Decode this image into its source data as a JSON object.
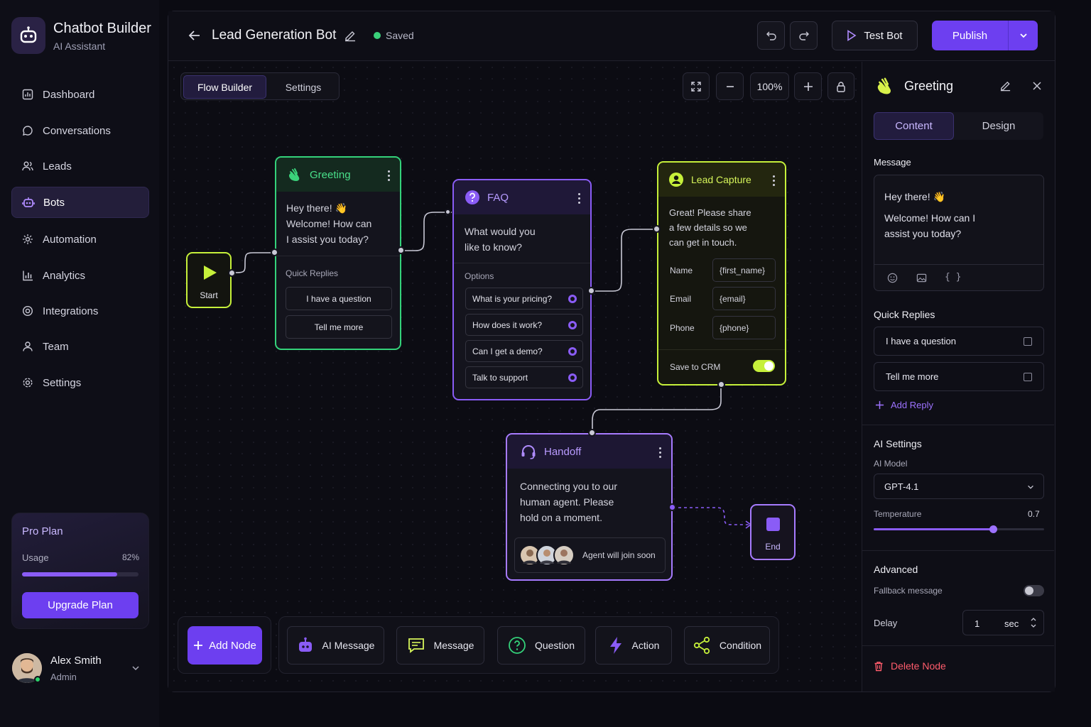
{
  "app": {
    "name": "Chatbot Builder",
    "subtitle": "AI Assistant"
  },
  "sidebar": {
    "items": [
      {
        "label": "Dashboard",
        "icon": "dashboard-icon"
      },
      {
        "label": "Conversations",
        "icon": "chat-bubble-icon"
      },
      {
        "label": "Leads",
        "icon": "users-icon"
      },
      {
        "label": "Bots",
        "icon": "bot-icon",
        "active": true
      },
      {
        "label": "Automation",
        "icon": "automation-icon"
      },
      {
        "label": "Analytics",
        "icon": "bar-chart-icon"
      },
      {
        "label": "Integrations",
        "icon": "integrations-icon"
      },
      {
        "label": "Team",
        "icon": "team-icon"
      },
      {
        "label": "Settings",
        "icon": "gear-icon"
      }
    ],
    "plan": {
      "title": "Pro Plan",
      "usage_label": "Usage",
      "usage_pct_label": "82%",
      "usage_fraction": 0.82,
      "upgrade_label": "Upgrade Plan"
    },
    "user": {
      "name": "Alex Smith",
      "role": "Admin"
    }
  },
  "header": {
    "bot_title": "Lead Generation Bot",
    "status": "Saved",
    "test_label": "Test Bot",
    "publish_label": "Publish"
  },
  "canvas": {
    "tabs": [
      "Flow Builder",
      "Settings"
    ],
    "zoom": "100%",
    "nodes": {
      "start": {
        "label": "Start"
      },
      "greeting": {
        "title": "Greeting",
        "message": [
          "Hey there! 👋",
          "Welcome! How can",
          "I assist you today?"
        ],
        "quick_replies_label": "Quick Replies",
        "quick_replies": [
          "I have a question",
          "Tell me more"
        ]
      },
      "faq": {
        "title": "FAQ",
        "message": [
          "What would you",
          "like to know?"
        ],
        "options_label": "Options",
        "options": [
          "What is your pricing?",
          "How does it work?",
          "Can I get a demo?",
          "Talk to support"
        ]
      },
      "lead_capture": {
        "title": "Lead Capture",
        "message": [
          "Great! Please share",
          "a few details so we",
          "can get in touch."
        ],
        "fields": [
          {
            "label": "Name",
            "value": "{first_name}"
          },
          {
            "label": "Email",
            "value": "{email}"
          },
          {
            "label": "Phone",
            "value": "{phone}"
          }
        ],
        "crm_label": "Save to CRM",
        "crm_enabled": true
      },
      "handoff": {
        "title": "Handoff",
        "message": [
          "Connecting you to our",
          "human agent. Please",
          "hold on a moment."
        ],
        "agent_note": "Agent will join soon"
      },
      "end": {
        "label": "End"
      }
    }
  },
  "toolbar": {
    "add_node_label": "Add Node",
    "palette": [
      {
        "label": "AI Message",
        "icon": "ai-bot-icon"
      },
      {
        "label": "Message",
        "icon": "message-icon"
      },
      {
        "label": "Question",
        "icon": "question-icon"
      },
      {
        "label": "Action",
        "icon": "lightning-icon"
      },
      {
        "label": "Condition",
        "icon": "branch-icon"
      }
    ]
  },
  "panel": {
    "title": "Greeting",
    "tabs": [
      "Content",
      "Design"
    ],
    "message_label": "Message",
    "message_lines": [
      "Hey there! 👋",
      "Welcome! How can I",
      "assist you today?"
    ],
    "quick_replies_label": "Quick Replies",
    "quick_replies": [
      "I have a question",
      "Tell me more"
    ],
    "add_reply_label": "Add Reply",
    "ai_settings_label": "AI Settings",
    "ai_model_label": "AI Model",
    "ai_model_value": "GPT-4.1",
    "temperature_label": "Temperature",
    "temperature_value": "0.7",
    "temperature": 0.7,
    "advanced_label": "Advanced",
    "fallback_label": "Fallback message",
    "fallback_enabled": false,
    "delay_label": "Delay",
    "delay_value": "1",
    "delay_unit": "sec",
    "delete_label": "Delete Node"
  },
  "colors": {
    "accent": "#6d3ff0",
    "greeting": "#34d27a",
    "faq": "#8a5cf6",
    "lead": "#c6f03a",
    "handoff": "#a77bff",
    "danger": "#ff5c6c"
  }
}
